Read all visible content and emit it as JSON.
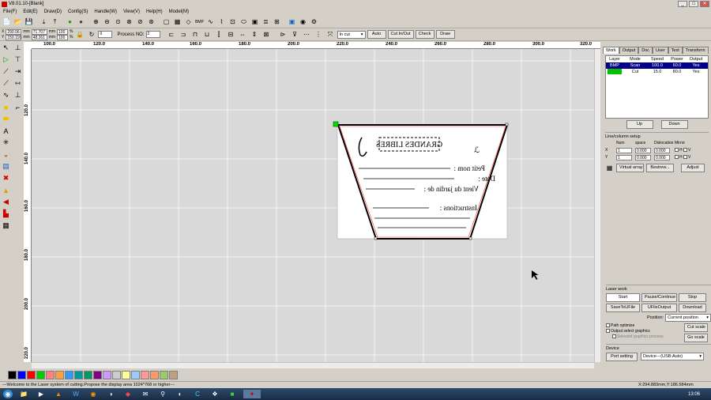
{
  "titlebar": {
    "title": "V8.01.10-[Blank]",
    "minimize": "_",
    "maximize": "□",
    "close": "✕"
  },
  "menu": [
    "File(F)",
    "Edit(E)",
    "Draw(D)",
    "Config(S)",
    "Handle(W)",
    "View(V)",
    "Help(H)",
    "Model(M)"
  ],
  "toolbar2": {
    "x_label": "X",
    "x_value": "290.06",
    "x_unit": "mm",
    "y_label": "Y",
    "y_value": "150.116",
    "y_unit": "mm",
    "w_value": "71.707",
    "w_unit": "mm",
    "h_value": "48.261",
    "h_unit": "mm",
    "pct1": "100",
    "pct2": "100",
    "pct_unit": "%",
    "angle": "0",
    "process_label": "Process NO:",
    "process_no": "2",
    "cut_mode": "In cut",
    "btn_auto": "Auto",
    "btn_cut_in_out": "Cut In/Out",
    "btn_check": "Check",
    "btn_draw": "Draw"
  },
  "ruler": {
    "h_ticks": [
      "100.0",
      "120.0",
      "140.0",
      "160.0",
      "180.0",
      "200.0",
      "220.0",
      "240.0",
      "260.0",
      "280.0",
      "300.0",
      "320.0"
    ],
    "v_ticks": [
      "120.0",
      "140.0",
      "160.0",
      "180.0",
      "200.0",
      "220.0"
    ]
  },
  "design": {
    "header_text": "GRANDES LIBRES",
    "line1": "Petit nom :",
    "line2": "Date :",
    "line3": "Vient du jardin de :",
    "line4": "Instructions :"
  },
  "panel": {
    "tabs": [
      "Work",
      "Output",
      "Doc",
      "User",
      "Test",
      "Transform"
    ],
    "layer_headers": [
      "Layer",
      "Mode",
      "Speed",
      "Power",
      "Output"
    ],
    "layers": [
      {
        "layer": "BMP",
        "mode": "Scan",
        "speed": "100.0",
        "power": "60.0",
        "output": "Yes",
        "color": "#000000"
      },
      {
        "layer": "",
        "mode": "Cut",
        "speed": "15.0",
        "power": "80.0",
        "output": "Yes",
        "color": "#00c000"
      }
    ],
    "btn_up": "Up",
    "btn_down": "Down",
    "linecol_title": "Line/column setup",
    "lc_headers": [
      "",
      "Num",
      "space",
      "Dislocation",
      "Mirror"
    ],
    "lc_x": {
      "label": "X",
      "num": "1",
      "space": "0.000",
      "disloc": "0.000",
      "m1": "H",
      "m2": "V"
    },
    "lc_y": {
      "label": "Y",
      "num": "1",
      "space": "0.000",
      "disloc": "0.000",
      "m1": "H",
      "m2": "V"
    },
    "btn_virtual": "Virtual array",
    "btn_bestrew": "Bestrew...",
    "btn_adjust": "Adjust"
  },
  "laser_work": {
    "title": "Laser work",
    "btn_start": "Start",
    "btn_pause": "Pause/Continue",
    "btn_stop": "Stop",
    "btn_save": "SaveToUFile",
    "btn_ufile": "UFileOutput",
    "btn_download": "Download",
    "position_label": "Position:",
    "position_value": "Current position",
    "path_opt": "Path optimize",
    "output_sel": "Output select graphics",
    "selected_graphics": "Selected graphics process",
    "btn_cut_scale": "Cut scale",
    "btn_go_scale": "Go scale",
    "device_title": "Device",
    "btn_port": "Port setting",
    "device_value": "Device---(USB:Auto)"
  },
  "palette": [
    "#000000",
    "#0000ff",
    "#ff0000",
    "#00cc00",
    "#ff8080",
    "#ffa040",
    "#3399ff",
    "#009999",
    "#009966",
    "#800080",
    "#cc99ff",
    "#cccccc",
    "#ffff99",
    "#99ccff",
    "#ff9999",
    "#ff9966",
    "#99cc66",
    "#c0a080"
  ],
  "status": {
    "message": "---Welcome to the Laser system of cutting.Propose the display area 1024*768 or higher---",
    "coords": "X:294.883mm,Y:186.584mm"
  },
  "taskbar": {
    "clock": "13:06"
  }
}
